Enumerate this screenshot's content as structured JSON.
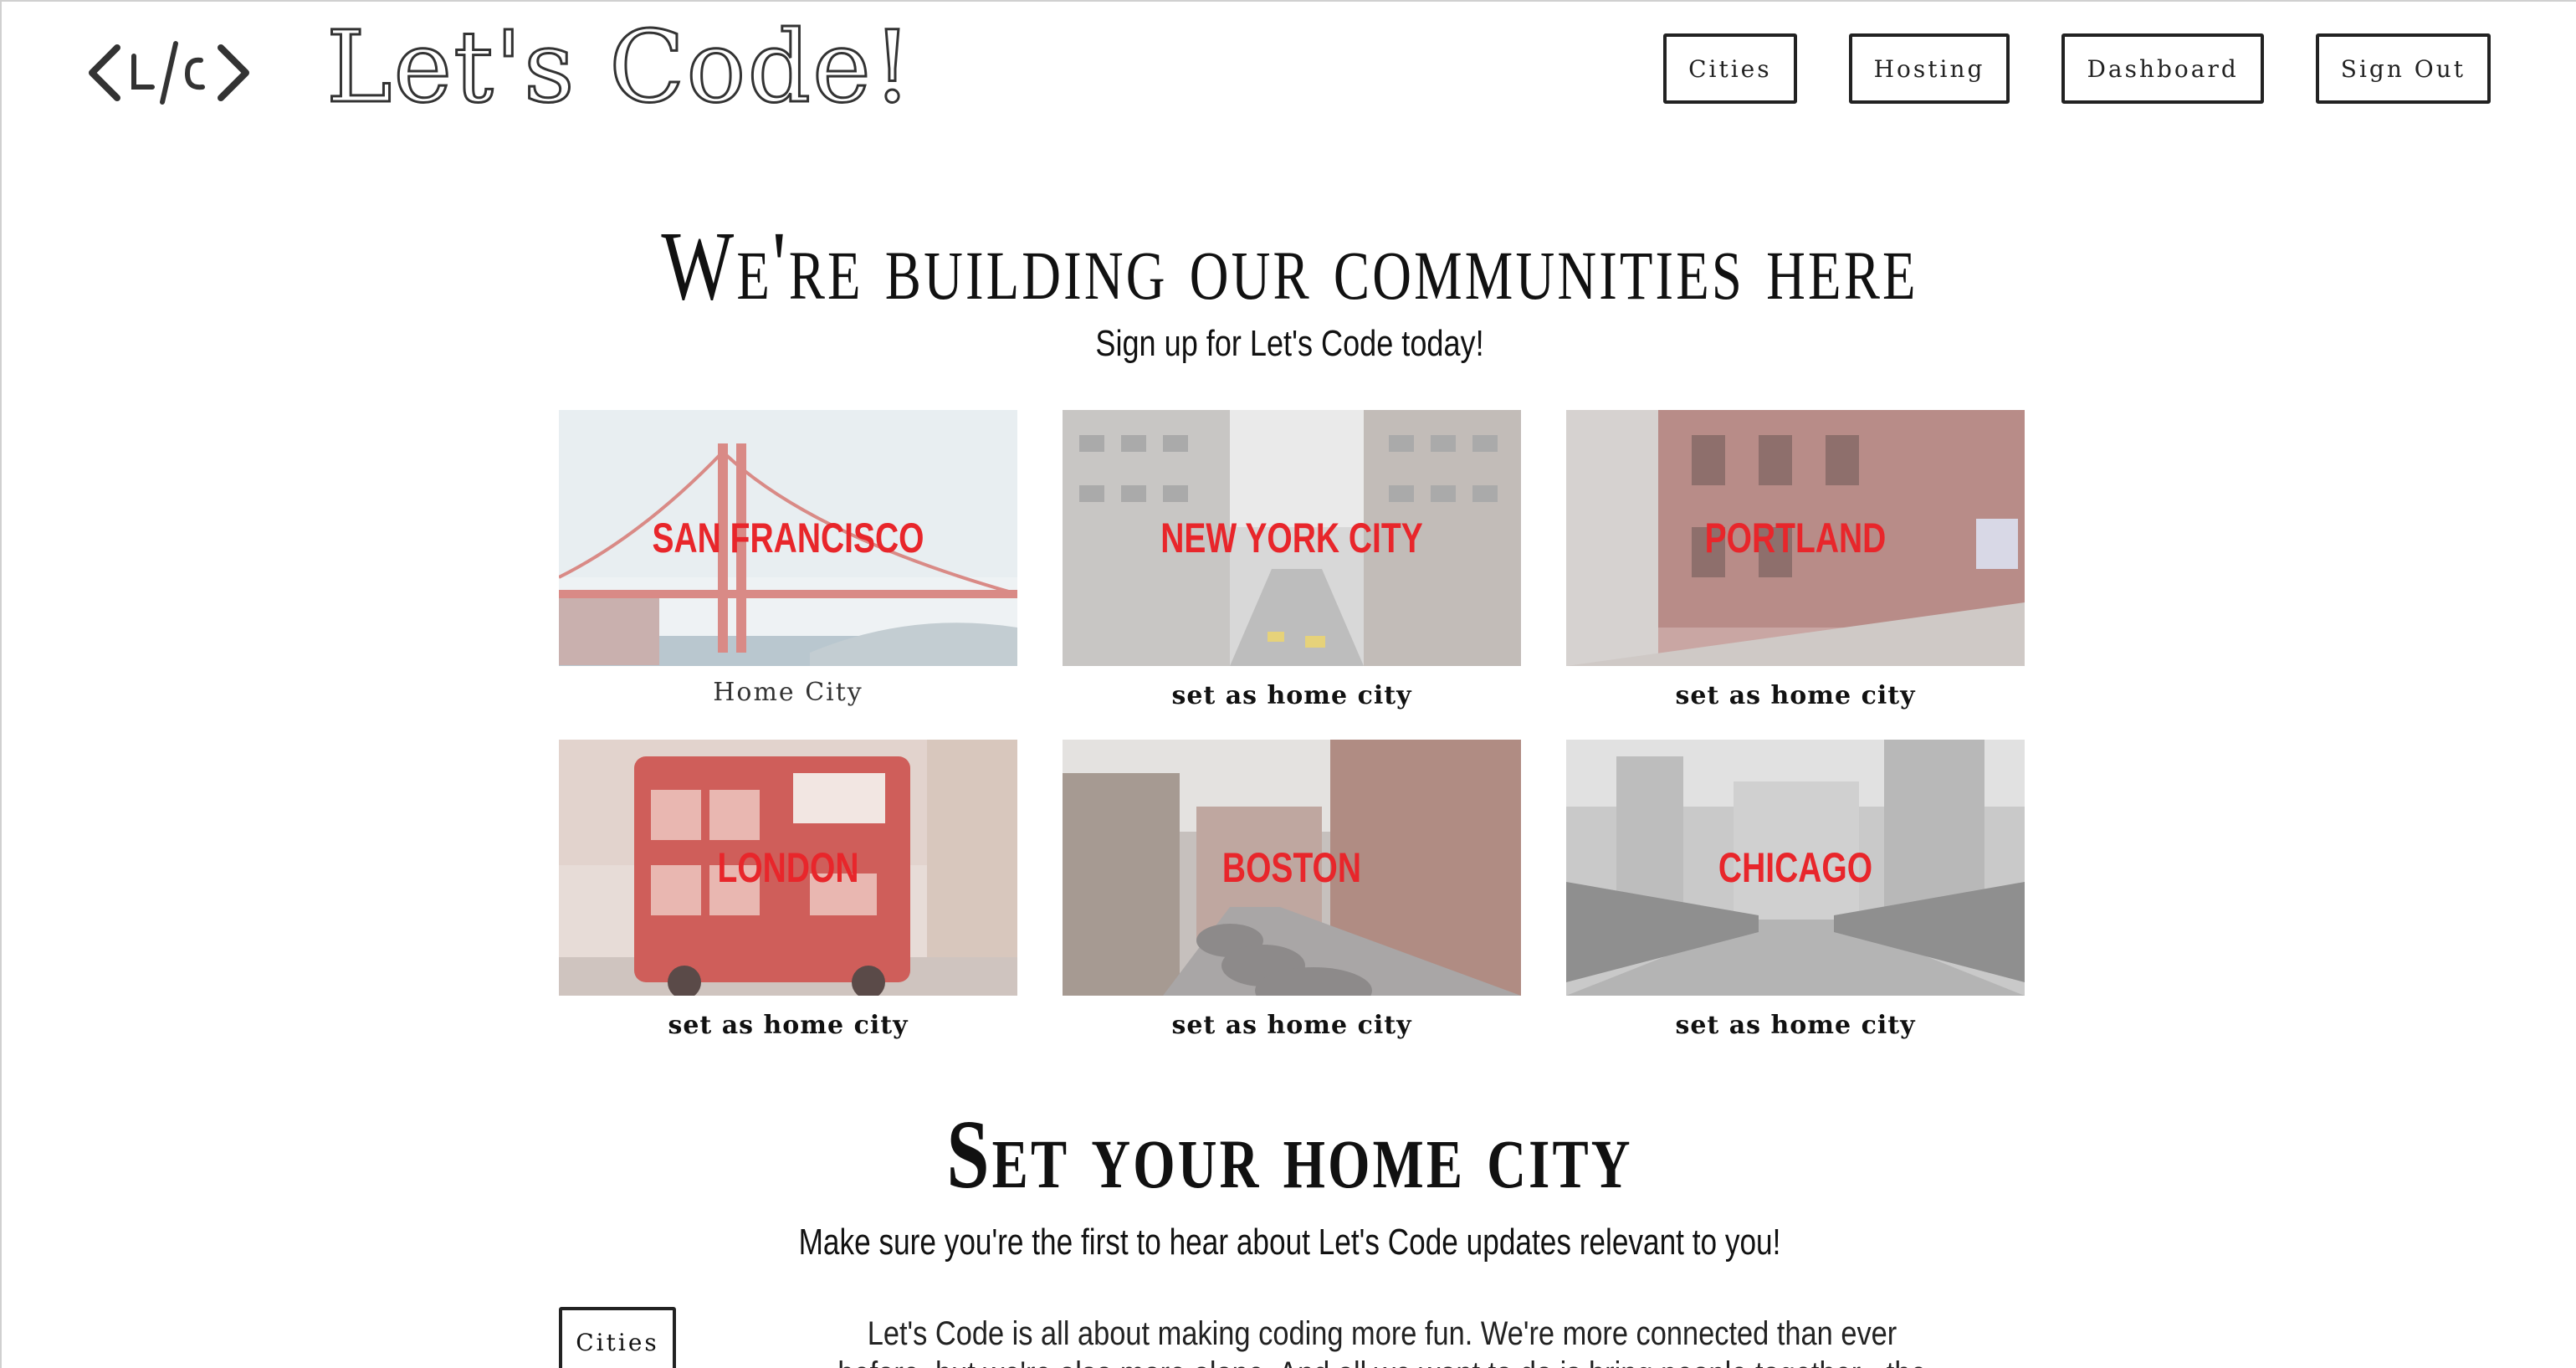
{
  "header": {
    "logo_mark": "<L/C>",
    "logo_text": "Let's Code!",
    "nav": [
      {
        "label": "Cities"
      },
      {
        "label": "Hosting"
      },
      {
        "label": "Dashboard"
      },
      {
        "label": "Sign Out"
      }
    ]
  },
  "hero": {
    "title": "We're building our communities here",
    "subtitle": "Sign up for Let's Code today!"
  },
  "cities": [
    {
      "name": "SAN FRANCISCO",
      "action": "Home City",
      "is_home": true
    },
    {
      "name": "NEW YORK CITY",
      "action": "set as home city",
      "is_home": false
    },
    {
      "name": "PORTLAND",
      "action": "set as home city",
      "is_home": false
    },
    {
      "name": "LONDON",
      "action": "set as home city",
      "is_home": false
    },
    {
      "name": "BOSTON",
      "action": "set as home city",
      "is_home": false
    },
    {
      "name": "CHICAGO",
      "action": "set as home city",
      "is_home": false
    }
  ],
  "home_section": {
    "title": "Set your home city",
    "subtitle": "Make sure you're the first to hear about Let's Code updates relevant to you!",
    "button": "Cities",
    "about": "Let's Code is all about making coding more fun. We're more connected than ever before, but we're also more alone. And all we want to do is bring people together - the world is better that way."
  },
  "colors": {
    "city_label": "#e8262b",
    "border": "#222222",
    "background": "#ffffff"
  }
}
